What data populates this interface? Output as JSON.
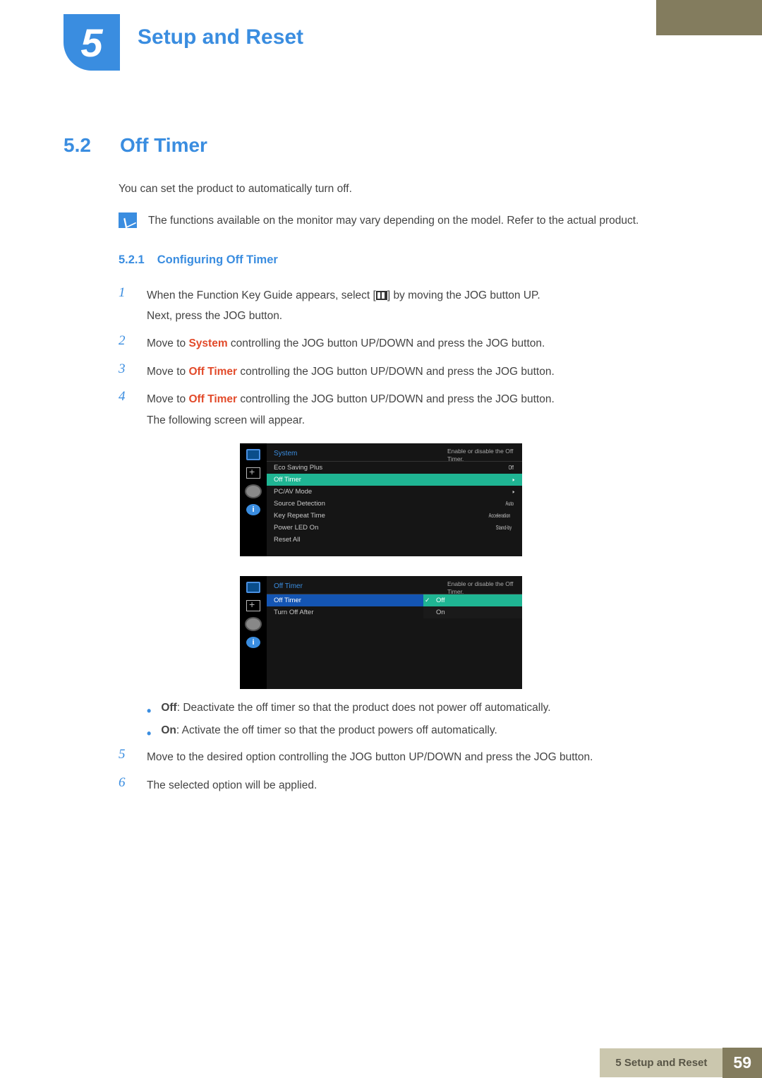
{
  "chapter": {
    "number": "5",
    "title": "Setup and Reset"
  },
  "section": {
    "number": "5.2",
    "title": "Off Timer"
  },
  "intro": "You can set the product to automatically turn off.",
  "note": "The functions available on the monitor may vary depending on the model. Refer to the actual product.",
  "subsection": {
    "number": "5.2.1",
    "title": "Configuring Off Timer"
  },
  "steps": {
    "s1a": "When the Function Key Guide appears, select [",
    "s1b": "] by moving the JOG button UP.",
    "s1_next": "Next, press the JOG button.",
    "s2a": "Move to ",
    "s2_kw": "System",
    "s2b": " controlling the JOG button UP/DOWN and press the JOG button.",
    "s3a": "Move to ",
    "s3_kw": "Off Timer",
    "s3b": " controlling the JOG button UP/DOWN and press the JOG button.",
    "s4a": "Move to ",
    "s4_kw": "Off Timer",
    "s4b": " controlling the JOG button UP/DOWN and press the JOG button.",
    "s4_next": "The following screen will appear.",
    "s5": "Move to the desired option controlling the JOG button UP/DOWN and press the JOG button.",
    "s6": "The selected option will be applied."
  },
  "step_nums": {
    "n1": "1",
    "n2": "2",
    "n3": "3",
    "n4": "4",
    "n5": "5",
    "n6": "6"
  },
  "osd1": {
    "header": "System",
    "hint": "Enable or disable the Off Timer.",
    "rows": [
      {
        "label": "Eco Saving Plus",
        "value": "Off"
      },
      {
        "label": "Off Timer",
        "value": "▸",
        "sel": true
      },
      {
        "label": "PC/AV Mode",
        "value": "▸"
      },
      {
        "label": "Source Detection",
        "value": "Auto"
      },
      {
        "label": "Key Repeat Time",
        "value": "Acceleration"
      },
      {
        "label": "Power LED On",
        "value": "Stand-by"
      },
      {
        "label": "Reset All",
        "value": ""
      }
    ]
  },
  "osd2": {
    "header": "Off Timer",
    "hint": "Enable or disable the Off Timer.",
    "rows": [
      {
        "label": "Off Timer",
        "value": "",
        "selblue": true
      },
      {
        "label": "Turn Off After",
        "value": ""
      }
    ],
    "options": [
      {
        "label": "Off",
        "sel": true,
        "check": "✓"
      },
      {
        "label": "On"
      }
    ]
  },
  "bullets": {
    "off_lbl": "Off",
    "off_txt": ": Deactivate the off timer so that the product does not power off automatically.",
    "on_lbl": "On",
    "on_txt": ": Activate the off timer so that the product powers off automatically."
  },
  "footer": {
    "chapter": "5 Setup and Reset",
    "page": "59"
  },
  "icon_info_glyph": "i"
}
